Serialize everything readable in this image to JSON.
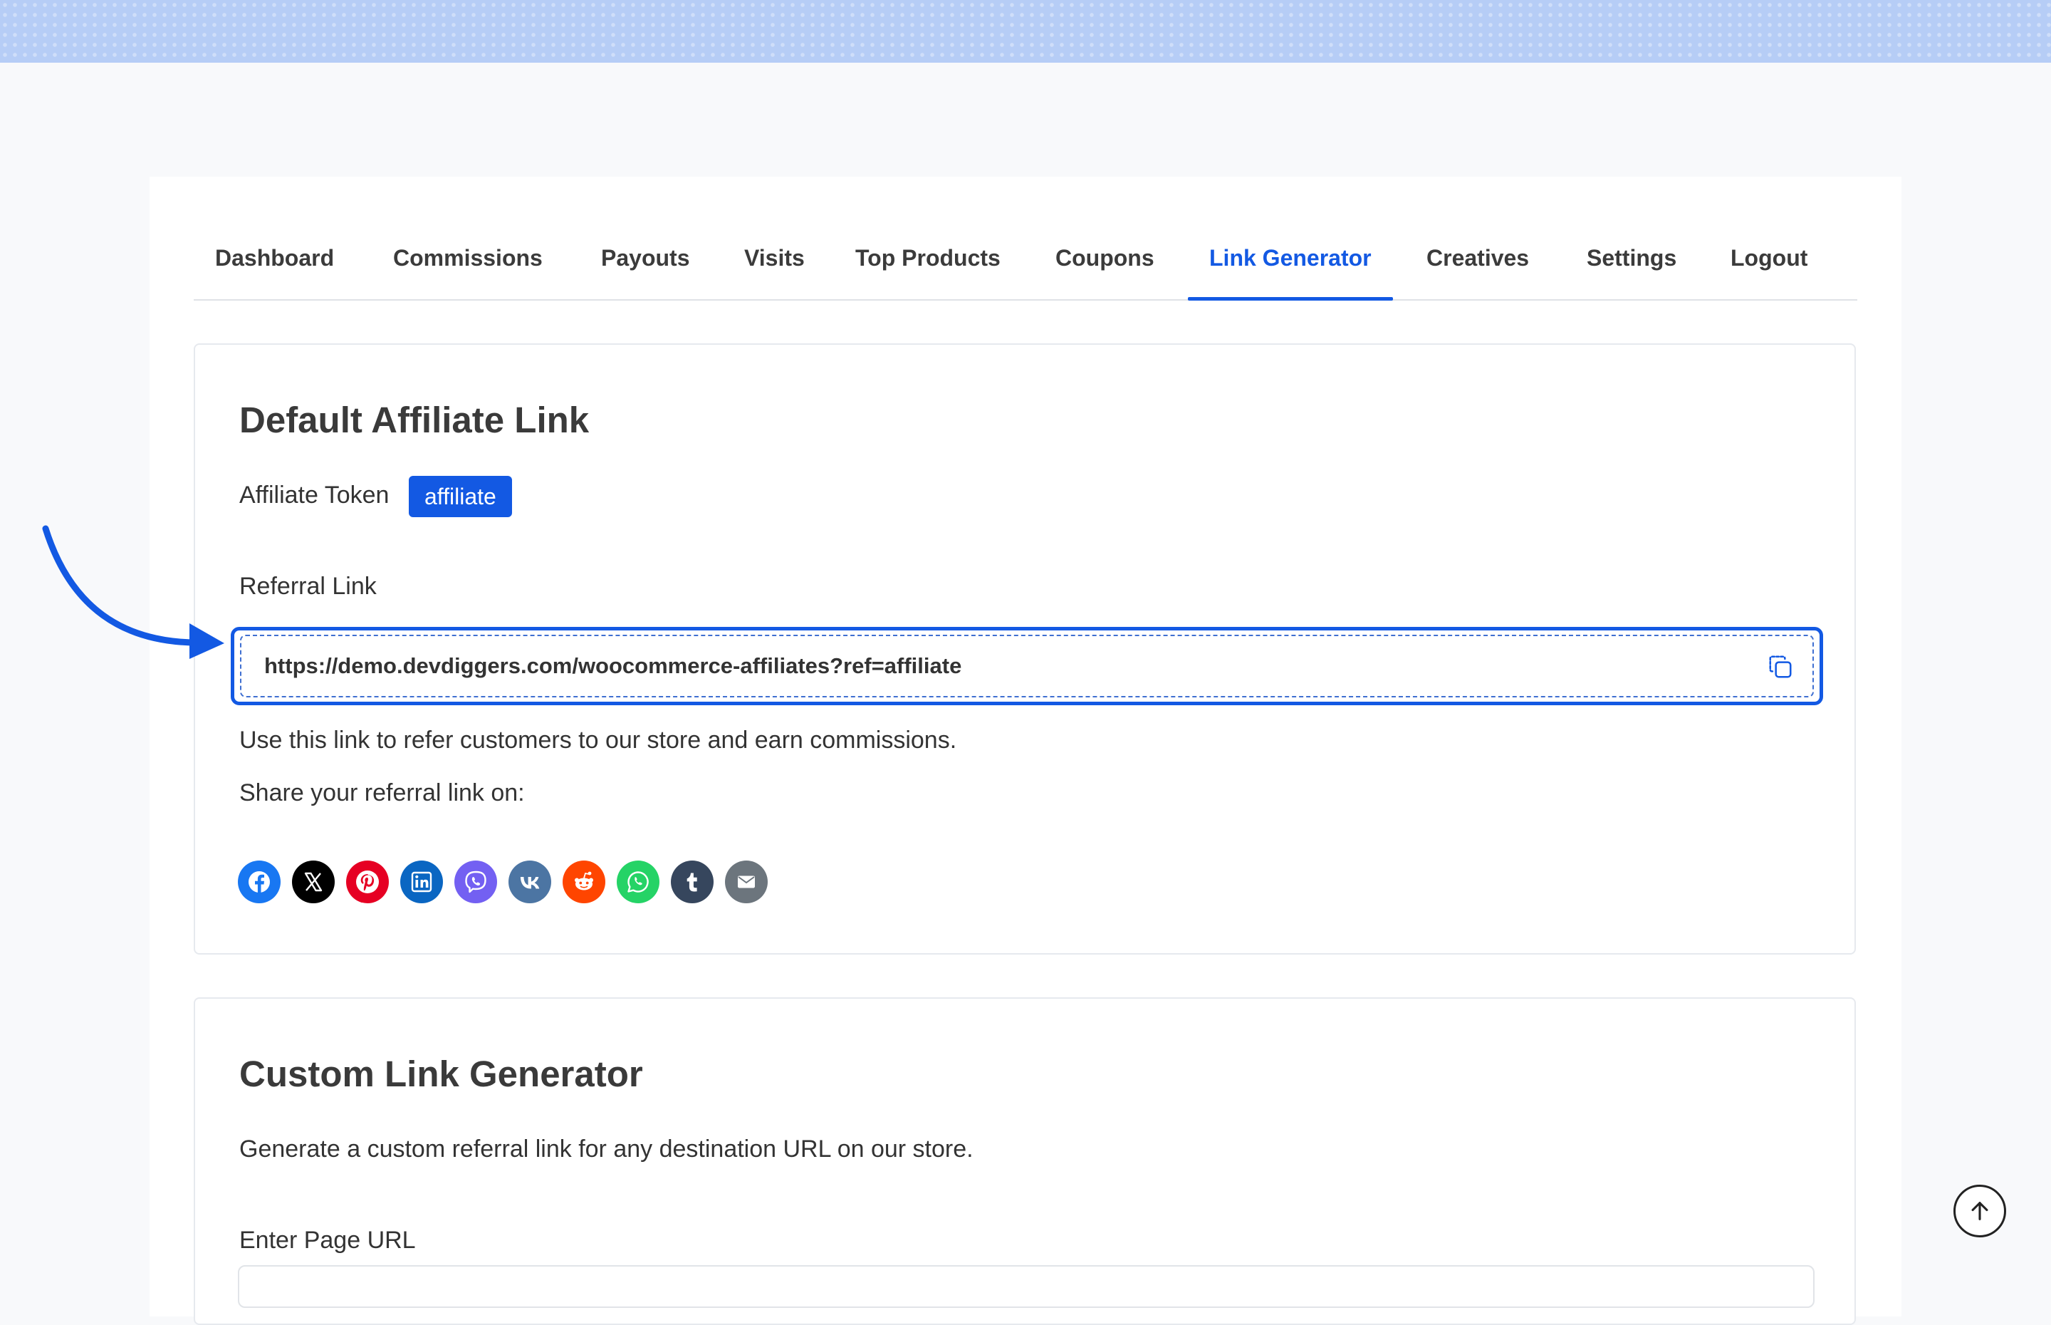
{
  "nav": {
    "tabs": [
      {
        "label": "Dashboard"
      },
      {
        "label": "Commissions"
      },
      {
        "label": "Payouts"
      },
      {
        "label": "Visits"
      },
      {
        "label": "Top Products"
      },
      {
        "label": "Coupons"
      },
      {
        "label": "Link Generator",
        "active": true
      },
      {
        "label": "Creatives"
      },
      {
        "label": "Settings"
      },
      {
        "label": "Logout"
      }
    ]
  },
  "default_link": {
    "title": "Default Affiliate Link",
    "token_label": "Affiliate Token",
    "token_value": "affiliate",
    "referral_label": "Referral Link",
    "referral_url": "https://demo.devdiggers.com/woocommerce-affiliates?ref=affiliate",
    "description": "Use this link to refer customers to our store and earn commissions.",
    "share_label": "Share your referral link on:",
    "share_icons": [
      {
        "name": "facebook-icon",
        "color": "#1877f2"
      },
      {
        "name": "x-icon",
        "color": "#000000"
      },
      {
        "name": "pinterest-icon",
        "color": "#e60023"
      },
      {
        "name": "linkedin-icon",
        "color": "#0a66c2"
      },
      {
        "name": "viber-icon",
        "color": "#7360f2"
      },
      {
        "name": "vk-icon",
        "color": "#4c75a3"
      },
      {
        "name": "reddit-icon",
        "color": "#ff4500"
      },
      {
        "name": "whatsapp-icon",
        "color": "#25d366"
      },
      {
        "name": "tumblr-icon",
        "color": "#36465d"
      },
      {
        "name": "email-icon",
        "color": "#6c757d"
      }
    ]
  },
  "custom_link": {
    "title": "Custom Link Generator",
    "description": "Generate a custom referral link for any destination URL on our store.",
    "url_label": "Enter Page URL"
  },
  "colors": {
    "accent": "#1359e3",
    "banner": "#b6cdf6"
  }
}
